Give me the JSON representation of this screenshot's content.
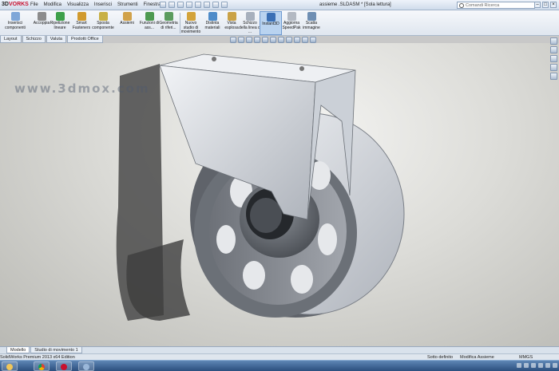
{
  "app": {
    "logo_prefix": "3D",
    "logo_suffix": "VORKS",
    "window_title": "assieme .SLDASM * [Sola lettura]",
    "menu": [
      "File",
      "Modifica",
      "Visualizza",
      "Inserisci",
      "Strumenti",
      "Finestra"
    ],
    "search_placeholder": "Comandi Ricerca",
    "watermark": "www.3dmox.com",
    "window_buttons": [
      "–",
      "□",
      "×"
    ]
  },
  "ribbon": {
    "items": [
      {
        "label": "Inserisci componenti",
        "name": "insert-components"
      },
      {
        "label": "Accoppia",
        "name": "mate"
      },
      {
        "label": "Ripetizione lineare",
        "name": "linear-pattern"
      },
      {
        "label": "Smart Fasteners",
        "name": "smart-fasteners"
      },
      {
        "label": "Sposta componente",
        "name": "move-component"
      },
      {
        "label": "Assiemi",
        "name": "assemblies"
      },
      {
        "label": "Funzioni di ass...",
        "name": "assembly-features"
      },
      {
        "label": "Geometria di riferi...",
        "name": "reference-geometry"
      },
      {
        "label": "Nuovo studio di movimento",
        "name": "new-motion-study"
      },
      {
        "label": "Distinta materiali",
        "name": "bill-of-materials"
      },
      {
        "label": "Vista esplosa",
        "name": "exploded-view"
      },
      {
        "label": "Schizzo della linea di ...",
        "name": "explode-line-sketch"
      },
      {
        "label": "Instant3D",
        "name": "instant3d"
      },
      {
        "label": "Aggiorna SpeedPak",
        "name": "update-speedpak"
      },
      {
        "label": "Scatta immagine",
        "name": "take-snapshot"
      }
    ]
  },
  "cm_tabs": [
    "Layout",
    "Schizzo",
    "Valuta",
    "Prodotti Office"
  ],
  "model_tabs": [
    "Modello",
    "Studio di movimento 1"
  ],
  "status": {
    "edition": "SolidWorks Premium 2013 x64 Edition",
    "definition": "Sotto definito",
    "mode": "Modifica Assieme",
    "units": "MMGS"
  },
  "colors": {
    "ribbon_active": "#b9d3f0",
    "taskbar": "#2b4f7e",
    "part_metal": "#d7dbe1",
    "logo_red": "#c8102e"
  }
}
